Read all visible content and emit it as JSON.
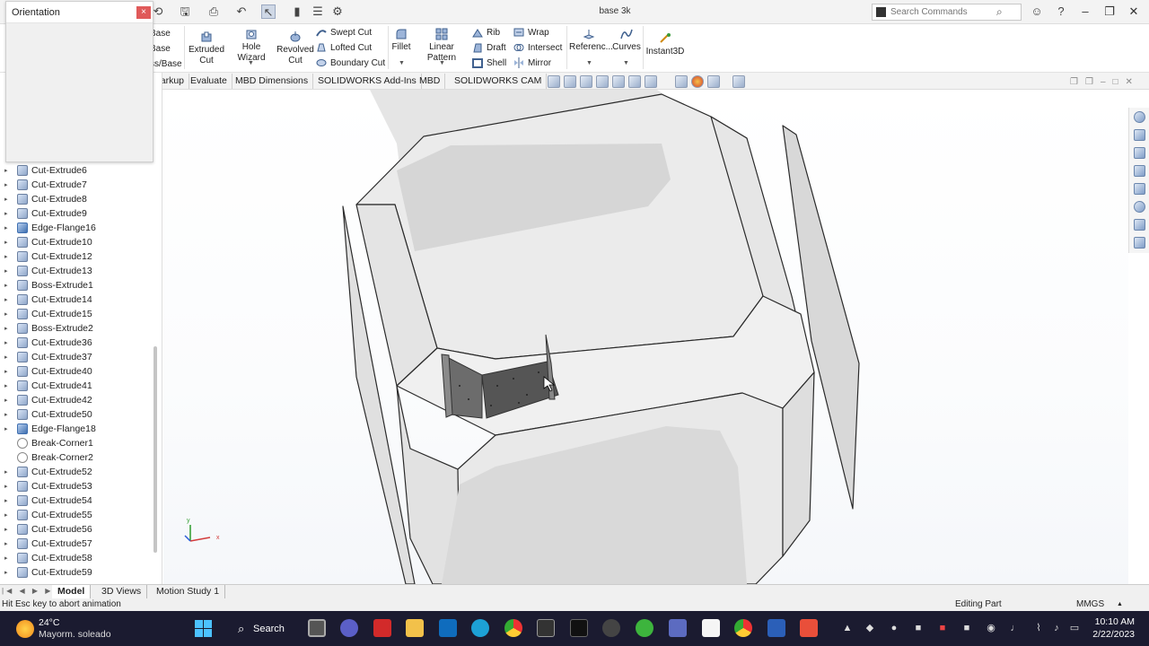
{
  "window": {
    "title": "base 3k"
  },
  "search": {
    "placeholder": "Search Commands"
  },
  "orientation_panel": {
    "title": "Orientation",
    "close": "×"
  },
  "ribbon": {
    "partial_labels": [
      "Base",
      "Base",
      "ss/Base"
    ],
    "extruded_cut": "Extruded Cut",
    "hole_wizard": "Hole Wizard",
    "revolved_cut": "Revolved Cut",
    "swept_cut": "Swept Cut",
    "lofted_cut": "Lofted Cut",
    "boundary_cut": "Boundary Cut",
    "fillet": "Fillet",
    "linear_pattern": "Linear Pattern",
    "rib": "Rib",
    "draft": "Draft",
    "shell": "Shell",
    "wrap": "Wrap",
    "intersect": "Intersect",
    "mirror": "Mirror",
    "reference": "Referenc...",
    "curves": "Curves",
    "instant3d": "Instant3D"
  },
  "tabs": [
    "Markup",
    "Evaluate",
    "MBD Dimensions",
    "SOLIDWORKS Add-Ins",
    "MBD",
    "SOLIDWORKS CAM"
  ],
  "feature_tree": [
    {
      "label": "Cut-Extrude6",
      "type": "cut"
    },
    {
      "label": "Cut-Extrude7",
      "type": "cut"
    },
    {
      "label": "Cut-Extrude8",
      "type": "cut"
    },
    {
      "label": "Cut-Extrude9",
      "type": "cut"
    },
    {
      "label": "Edge-Flange16",
      "type": "flange"
    },
    {
      "label": "Cut-Extrude10",
      "type": "cut"
    },
    {
      "label": "Cut-Extrude12",
      "type": "cut"
    },
    {
      "label": "Cut-Extrude13",
      "type": "cut"
    },
    {
      "label": "Boss-Extrude1",
      "type": "boss"
    },
    {
      "label": "Cut-Extrude14",
      "type": "cut"
    },
    {
      "label": "Cut-Extrude15",
      "type": "cut"
    },
    {
      "label": "Boss-Extrude2",
      "type": "boss"
    },
    {
      "label": "Cut-Extrude36",
      "type": "cut"
    },
    {
      "label": "Cut-Extrude37",
      "type": "cut"
    },
    {
      "label": "Cut-Extrude40",
      "type": "cut"
    },
    {
      "label": "Cut-Extrude41",
      "type": "cut"
    },
    {
      "label": "Cut-Extrude42",
      "type": "cut"
    },
    {
      "label": "Cut-Extrude50",
      "type": "cut"
    },
    {
      "label": "Edge-Flange18",
      "type": "flange"
    },
    {
      "label": "Break-Corner1",
      "type": "corner"
    },
    {
      "label": "Break-Corner2",
      "type": "corner"
    },
    {
      "label": "Cut-Extrude52",
      "type": "cut"
    },
    {
      "label": "Cut-Extrude53",
      "type": "cut"
    },
    {
      "label": "Cut-Extrude54",
      "type": "cut"
    },
    {
      "label": "Cut-Extrude55",
      "type": "cut"
    },
    {
      "label": "Cut-Extrude56",
      "type": "cut"
    },
    {
      "label": "Cut-Extrude57",
      "type": "cut"
    },
    {
      "label": "Cut-Extrude58",
      "type": "cut"
    },
    {
      "label": "Cut-Extrude59",
      "type": "cut"
    }
  ],
  "bottom_tabs": [
    "Model",
    "3D Views",
    "Motion Study 1"
  ],
  "status": {
    "left": "Hit Esc key to abort animation",
    "mode": "Editing Part",
    "units": "MMGS"
  },
  "triad": {
    "y": "y",
    "x": "x"
  },
  "taskbar": {
    "weather_temp": "24°C",
    "weather_desc": "Mayorm. soleado",
    "search_label": "Search",
    "time": "10:10 AM",
    "date": "2/22/2023"
  },
  "colors": {
    "accent": "#0078d4",
    "taskbar_bg": "#1b1b30",
    "close_red": "#e05a5a"
  }
}
